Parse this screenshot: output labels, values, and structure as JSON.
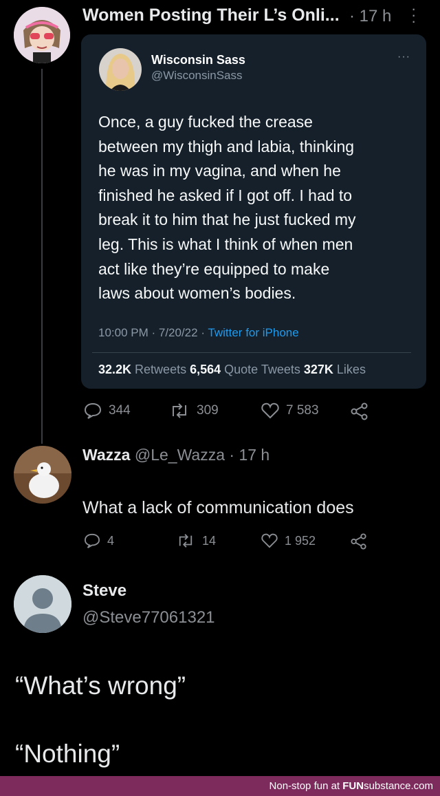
{
  "header": {
    "title": "Women Posting Their L’s Onli...",
    "time": "· 17 h",
    "more_icon": "vertical-dots-icon"
  },
  "embedded_tweet": {
    "name": "Wisconsin Sass",
    "handle": "@WisconsinSass",
    "more": "···",
    "lines": [
      "Once, a guy fucked the crease",
      "between my thigh and labia, thinking",
      "he was in my vagina, and when he",
      "finished he asked if I got off. I had to",
      "break it to him that he just fucked my",
      "leg. This is what I think of when men",
      "act like they’re equipped to make",
      "laws about women’s bodies."
    ],
    "meta": "10:00 PM · 7/20/22 · ",
    "source": "Twitter for iPhone",
    "retweets_count": "32.2K",
    "retweets_label": " Retweets ",
    "quotes_count": "6,564",
    "quotes_label": " Quote Tweets ",
    "likes_count": "327K",
    "likes_label": " Likes"
  },
  "post_actions": {
    "replies": "344",
    "reposts": "309",
    "likes": "7 583"
  },
  "reply": {
    "name": "Wazza",
    "handle_time": " @Le_Wazza · 17 h",
    "text": "What a lack of communication does",
    "replies": "4",
    "reposts": "14",
    "likes": "1 952"
  },
  "steve": {
    "name": "Steve",
    "handle": "@Steve77061321",
    "quote1": "“What’s wrong”",
    "quote2": "“Nothing”"
  },
  "footer": {
    "prefix": "Non-stop fun at ",
    "brand_bold": "FUN",
    "brand_rest": "substance",
    "suffix": ".com"
  },
  "colors": {
    "background": "#000000",
    "card": "#15202b",
    "link": "#1d9bf0",
    "footer": "#7d2a5c"
  }
}
